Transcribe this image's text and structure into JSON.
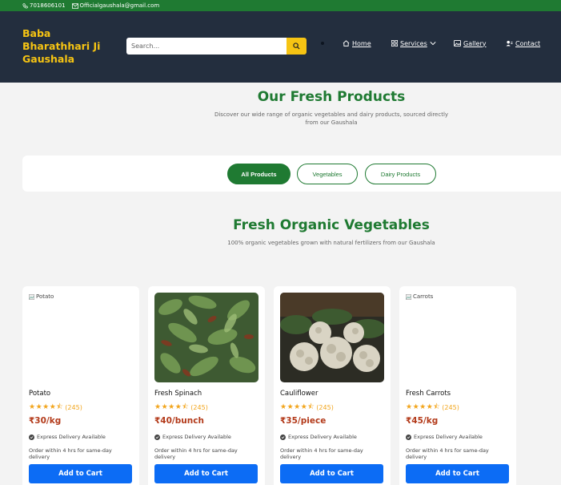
{
  "topbar": {
    "phone": "7018606101",
    "email": "Officialgaushala@gmail.com"
  },
  "header": {
    "brand_line1": "Baba",
    "brand_line2": "Bharathhari Ji",
    "brand_line3": "Gaushala",
    "search_placeholder": "Search...",
    "nav": {
      "home": "Home",
      "services": "Services",
      "gallery": "Gallery",
      "contact": "Contact"
    }
  },
  "hero": {
    "title": "Our Fresh Products",
    "subtitle_line1": "Discover our wide range of organic vegetables and dairy products, sourced directly",
    "subtitle_line2": "from our Gaushala"
  },
  "filters": {
    "all": "All Products",
    "vegetables": "Vegetables",
    "dairy": "Dairy Products"
  },
  "section": {
    "title": "Fresh Organic Vegetables",
    "subtitle": "100% organic vegetables grown with natural fertilizers from our Gaushala"
  },
  "products": [
    {
      "alt": "Potato",
      "name": "Potato",
      "reviews": "(245)",
      "price": "₹30/kg",
      "delivery": "Express Delivery Available",
      "order": "Order within 4 hrs for same-day delivery",
      "cta": "Add to Cart",
      "rating": 4.5
    },
    {
      "alt": "",
      "name": "Fresh Spinach",
      "reviews": "(245)",
      "price": "₹40/bunch",
      "delivery": "Express Delivery Available",
      "order": "Order within 4 hrs for same-day delivery",
      "cta": "Add to Cart",
      "rating": 4.5
    },
    {
      "alt": "",
      "name": "Cauliflower",
      "reviews": "(245)",
      "price": "₹35/piece",
      "delivery": "Express Delivery Available",
      "order": "Order within 4 hrs for same-day delivery",
      "cta": "Add to Cart",
      "rating": 4.5
    },
    {
      "alt": "Carrots",
      "name": "Fresh Carrots",
      "reviews": "(245)",
      "price": "₹45/kg",
      "delivery": "Express Delivery Available",
      "order": "Order within 4 hrs for same-day delivery",
      "cta": "Add to Cart",
      "rating": 4.5
    }
  ],
  "colors": {
    "green": "#1f7a32",
    "navy": "#232e3e",
    "yellow": "#f6c413",
    "blue": "#0c6cf5",
    "price": "#b33a1a"
  }
}
